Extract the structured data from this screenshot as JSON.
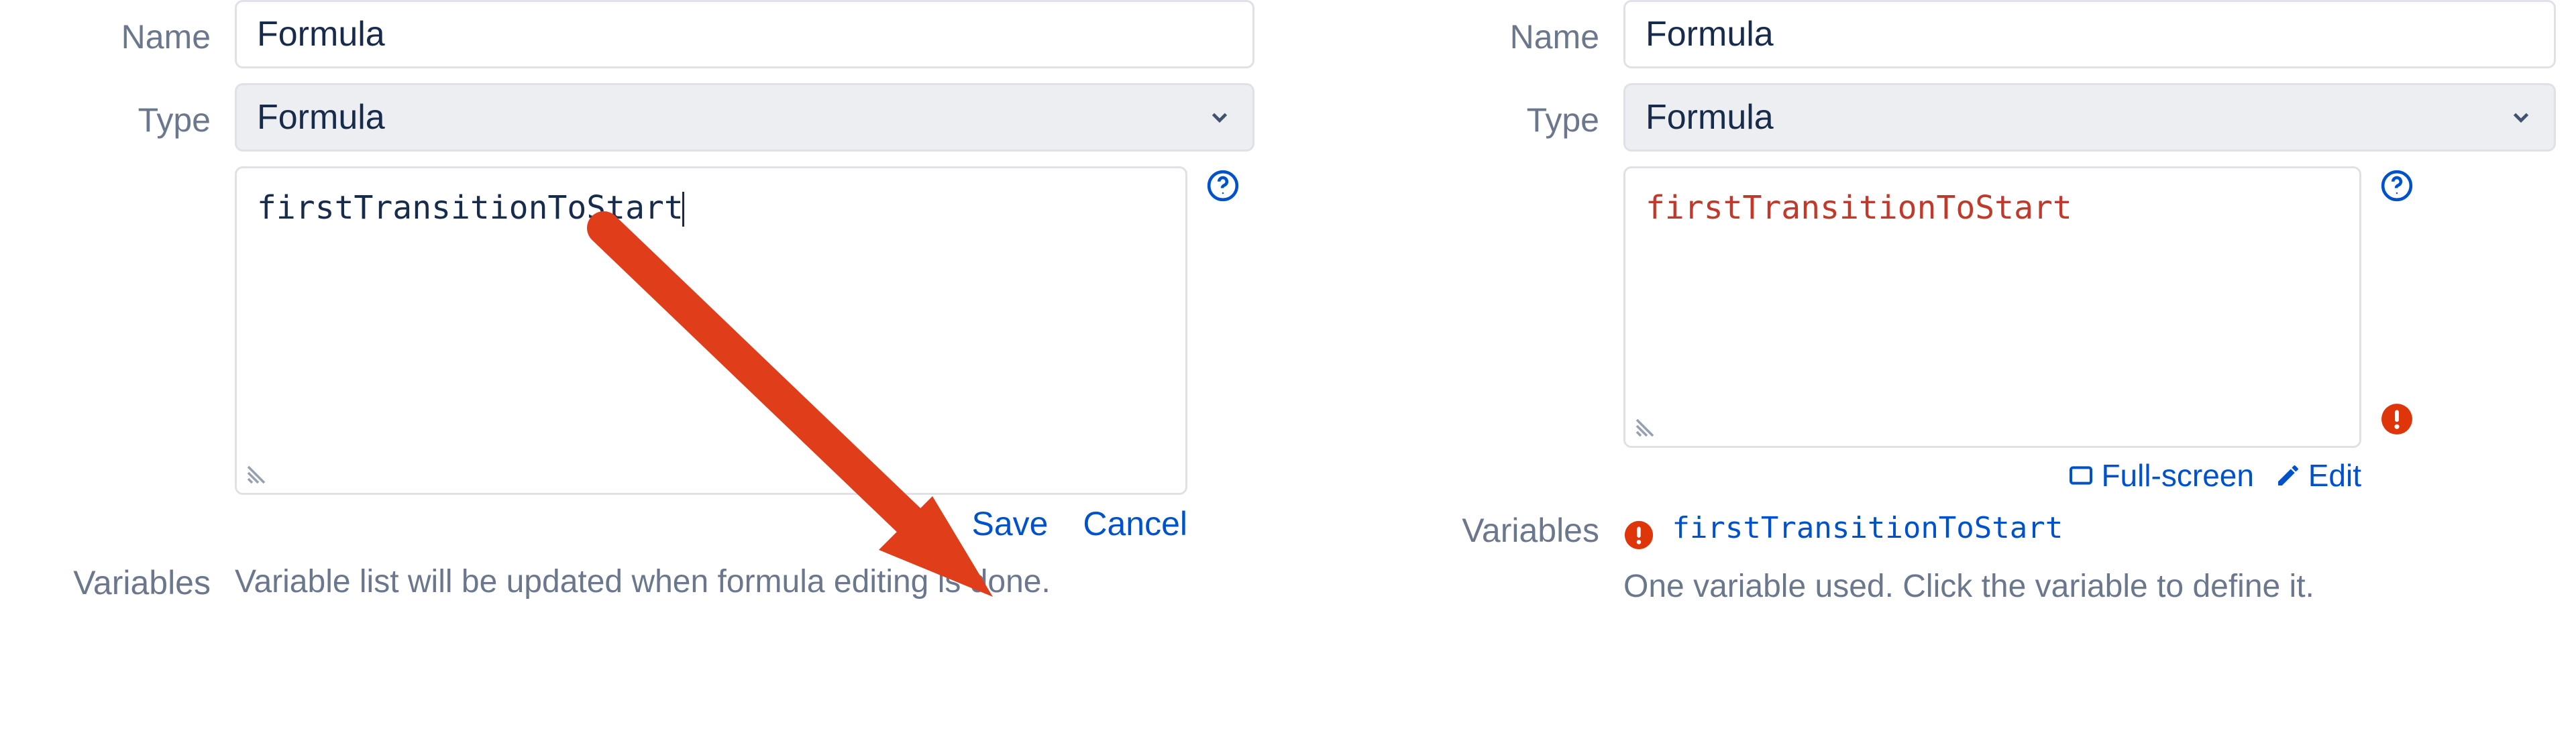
{
  "left": {
    "name_label": "Name",
    "name_value": "Formula",
    "type_label": "Type",
    "type_value": "Formula",
    "formula_text": "firstTransitionToStart",
    "save_label": "Save",
    "cancel_label": "Cancel",
    "variables_label": "Variables",
    "variables_hint": "Variable list will be updated when formula editing is done."
  },
  "right": {
    "name_label": "Name",
    "name_value": "Formula",
    "type_label": "Type",
    "type_value": "Formula",
    "formula_text": "firstTransitionToStart",
    "fullscreen_label": "Full-screen",
    "edit_label": "Edit",
    "variables_label": "Variables",
    "variable_name": "firstTransitionToStart",
    "variables_hint": "One variable used. Click the variable to define it."
  },
  "colors": {
    "link": "#0052cc",
    "error": "#de350b",
    "muted": "#6b778c",
    "arrow": "#e03e1a"
  }
}
